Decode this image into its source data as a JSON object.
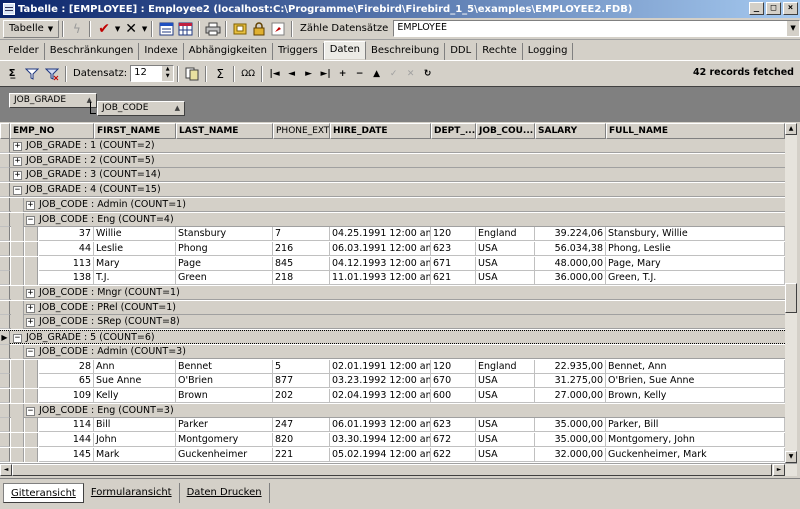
{
  "window": {
    "title": "Tabelle : [EMPLOYEE] : Employee2 (localhost:C:\\Programme\\Firebird\\Firebird_1_5\\examples\\EMPLOYEE2.FDB)",
    "minimize": "_",
    "maximize": "□",
    "close": "×"
  },
  "toolbar": {
    "table_menu": "Tabelle",
    "count_label": "Zähle Datensätze",
    "table_combo": "EMPLOYEE"
  },
  "tabs": [
    "Felder",
    "Beschränkungen",
    "Indexe",
    "Abhängigkeiten",
    "Triggers",
    "Daten",
    "Beschreibung",
    "DDL",
    "Rechte",
    "Logging"
  ],
  "active_tab": "Daten",
  "datatoolbar": {
    "datensatz_label": "Datensatz:",
    "datensatz_value": "12",
    "sigma": "Σ",
    "omega": "ΩΩ",
    "nav": [
      "|◄",
      "◄",
      "►",
      "►|",
      "+",
      "−",
      "▲",
      "✓",
      "✕",
      "↻"
    ],
    "fetched": "42 records fetched"
  },
  "grouping": {
    "boxes": [
      "JOB_GRADE",
      "JOB_CODE"
    ]
  },
  "columns": [
    "EMP_NO",
    "FIRST_NAME",
    "LAST_NAME",
    "PHONE_EXT",
    "HIRE_DATE",
    "DEPT_...",
    "JOB_COU...",
    "SALARY",
    "FULL_NAME"
  ],
  "rows": [
    {
      "kind": "g1",
      "text": "JOB_GRADE : 1 (COUNT=2)",
      "exp": "+"
    },
    {
      "kind": "g1",
      "text": "JOB_GRADE : 2 (COUNT=5)",
      "exp": "+"
    },
    {
      "kind": "g1",
      "text": "JOB_GRADE : 3 (COUNT=14)",
      "exp": "+"
    },
    {
      "kind": "g1",
      "text": "JOB_GRADE : 4 (COUNT=15)",
      "exp": "−"
    },
    {
      "kind": "g2",
      "text": "JOB_CODE : Admin (COUNT=1)",
      "exp": "+"
    },
    {
      "kind": "g2",
      "text": "JOB_CODE : Eng (COUNT=4)",
      "exp": "−"
    },
    {
      "kind": "d",
      "cells": [
        "37",
        "Willie",
        "Stansbury",
        "7",
        "04.25.1991 12:00 am",
        "120",
        "England",
        "39.224,06",
        "Stansbury, Willie"
      ]
    },
    {
      "kind": "d",
      "cells": [
        "44",
        "Leslie",
        "Phong",
        "216",
        "06.03.1991 12:00 am",
        "623",
        "USA",
        "56.034,38",
        "Phong, Leslie"
      ]
    },
    {
      "kind": "d",
      "cells": [
        "113",
        "Mary",
        "Page",
        "845",
        "04.12.1993 12:00 am",
        "671",
        "USA",
        "48.000,00",
        "Page, Mary"
      ]
    },
    {
      "kind": "d",
      "cells": [
        "138",
        "T.J.",
        "Green",
        "218",
        "11.01.1993 12:00 am",
        "621",
        "USA",
        "36.000,00",
        "Green, T.J."
      ]
    },
    {
      "kind": "g2",
      "text": "JOB_CODE : Mngr (COUNT=1)",
      "exp": "+"
    },
    {
      "kind": "g2",
      "text": "JOB_CODE : PRel (COUNT=1)",
      "exp": "+"
    },
    {
      "kind": "g2",
      "text": "JOB_CODE : SRep (COUNT=8)",
      "exp": "+"
    },
    {
      "kind": "g1",
      "text": "JOB_GRADE : 5 (COUNT=6)",
      "exp": "−",
      "current": true
    },
    {
      "kind": "g2",
      "text": "JOB_CODE : Admin (COUNT=3)",
      "exp": "−"
    },
    {
      "kind": "d",
      "cells": [
        "28",
        "Ann",
        "Bennet",
        "5",
        "02.01.1991 12:00 am",
        "120",
        "England",
        "22.935,00",
        "Bennet, Ann"
      ]
    },
    {
      "kind": "d",
      "cells": [
        "65",
        "Sue Anne",
        "O'Brien",
        "877",
        "03.23.1992 12:00 am",
        "670",
        "USA",
        "31.275,00",
        "O'Brien, Sue Anne"
      ]
    },
    {
      "kind": "d",
      "cells": [
        "109",
        "Kelly",
        "Brown",
        "202",
        "02.04.1993 12:00 am",
        "600",
        "USA",
        "27.000,00",
        "Brown, Kelly"
      ]
    },
    {
      "kind": "g2",
      "text": "JOB_CODE : Eng (COUNT=3)",
      "exp": "−"
    },
    {
      "kind": "d",
      "cells": [
        "114",
        "Bill",
        "Parker",
        "247",
        "06.01.1993 12:00 am",
        "623",
        "USA",
        "35.000,00",
        "Parker, Bill"
      ]
    },
    {
      "kind": "d",
      "cells": [
        "144",
        "John",
        "Montgomery",
        "820",
        "03.30.1994 12:00 am",
        "672",
        "USA",
        "35.000,00",
        "Montgomery, John"
      ]
    },
    {
      "kind": "d",
      "cells": [
        "145",
        "Mark",
        "Guckenheimer",
        "221",
        "05.02.1994 12:00 am",
        "622",
        "USA",
        "32.000,00",
        "Guckenheimer, Mark"
      ]
    }
  ],
  "bottom_tabs": [
    "Gitteransicht",
    "Formularansicht",
    "Daten Drucken"
  ],
  "active_bottom_tab": "Gitteransicht"
}
